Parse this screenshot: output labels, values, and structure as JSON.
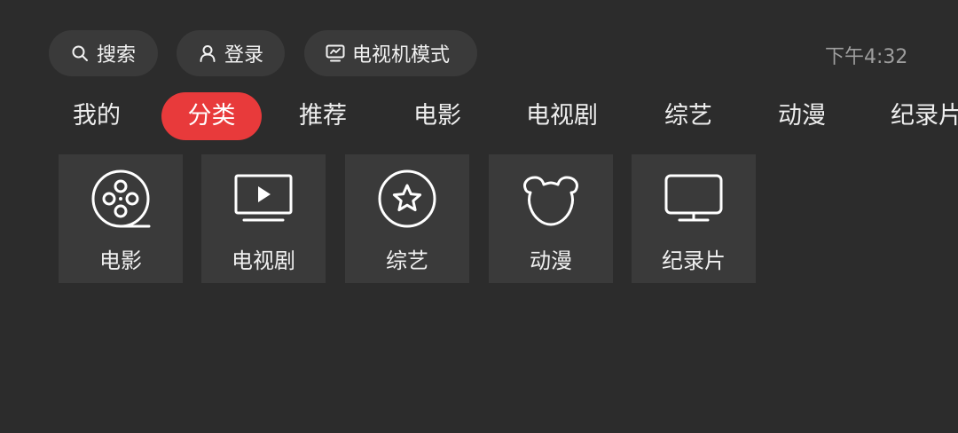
{
  "top_bar": {
    "search_label": "搜索",
    "login_label": "登录",
    "tv_mode_label": "电视机模式",
    "time": "下午4:32"
  },
  "nav": {
    "tabs": [
      {
        "label": "我的",
        "active": false
      },
      {
        "label": "分类",
        "active": true
      },
      {
        "label": "推荐",
        "active": false
      },
      {
        "label": "电影",
        "active": false
      },
      {
        "label": "电视剧",
        "active": false
      },
      {
        "label": "综艺",
        "active": false
      },
      {
        "label": "动漫",
        "active": false
      },
      {
        "label": "纪录片",
        "active": false
      }
    ]
  },
  "categories": [
    {
      "label": "电影",
      "icon": "film-reel-icon"
    },
    {
      "label": "电视剧",
      "icon": "tv-play-icon"
    },
    {
      "label": "综艺",
      "icon": "star-circle-icon"
    },
    {
      "label": "动漫",
      "icon": "bear-icon"
    },
    {
      "label": "纪录片",
      "icon": "monitor-icon"
    }
  ],
  "colors": {
    "background": "#2c2c2c",
    "surface": "#3a3a3a",
    "accent": "#e83a3b",
    "text": "#ffffff",
    "muted_text": "#9e9e9e"
  }
}
